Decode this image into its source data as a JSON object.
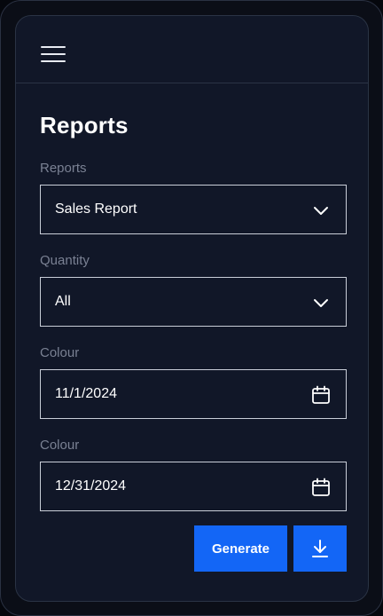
{
  "header": {
    "menu_icon": "hamburger-menu-icon"
  },
  "page": {
    "title": "Reports"
  },
  "form": {
    "fields": [
      {
        "label": "Reports",
        "value": "Sales Report",
        "icon": "chevron-down-icon"
      },
      {
        "label": "Quantity",
        "value": "All",
        "icon": "chevron-down-icon"
      },
      {
        "label": "Colour",
        "value": "11/1/2024",
        "icon": "calendar-icon"
      },
      {
        "label": "Colour",
        "value": "12/31/2024",
        "icon": "calendar-icon"
      }
    ]
  },
  "actions": {
    "generate_label": "Generate",
    "download_icon": "download-icon",
    "accent_color": "#1366f6"
  }
}
